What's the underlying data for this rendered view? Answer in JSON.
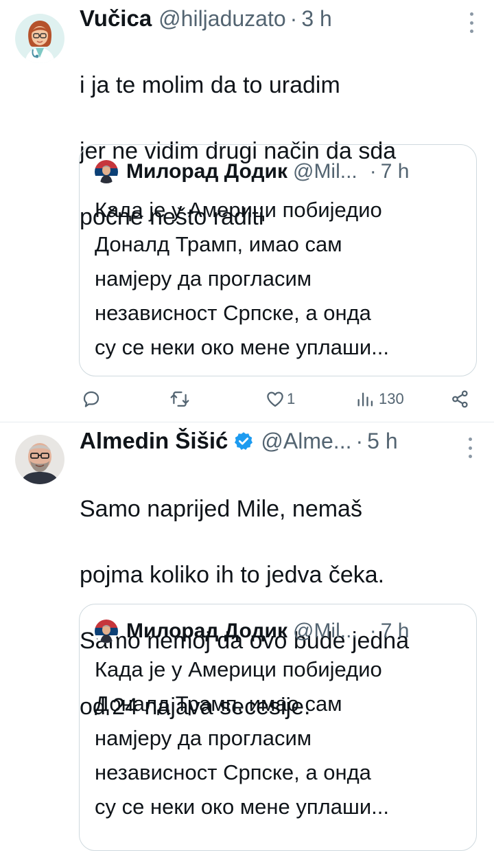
{
  "tweets": [
    {
      "display_name": "Vučica",
      "handle": "@hiljaduzato",
      "separator": "·",
      "time": "3 h",
      "text_lines": [
        "i ja te molim da to uradim",
        "jer ne vidim drugi način da sda",
        "počne nešto raditi"
      ],
      "quote": {
        "display_name": "Милорад Додик",
        "handle": "@Mil...",
        "separator": "·",
        "time": "7 h",
        "text_lines": [
          "Када је у Америци побиједио",
          "Доналд Трамп, имао сам",
          "намјеру да прогласим",
          "независност Српске, а онда",
          "су се неки око мене уплаши..."
        ]
      },
      "actions": {
        "reply_count": "",
        "retweet_count": "",
        "like_count": "1",
        "views_count": "130"
      }
    },
    {
      "display_name": "Almedin Šišić",
      "handle": "@Alme...",
      "separator": "·",
      "time": "5 h",
      "verified": true,
      "text_lines": [
        "Samo naprijed Mile, nemaš",
        "pojma koliko ih to jedva čeka.",
        "Samo nemoj da ovo bude jedna",
        "od 24 najava secesije."
      ],
      "quote": {
        "display_name": "Милорад Додик",
        "handle": "@Mil...",
        "separator": "·",
        "time": "7 h",
        "text_lines": [
          "Када је у Америци побиједио",
          "Доналд Трамп, имао сам",
          "намјеру да прогласим",
          "независност Српске, а онда",
          "су се неки око мене уплаши..."
        ]
      }
    }
  ],
  "icons": {
    "reply": "reply-icon",
    "retweet": "retweet-icon",
    "like": "heart-icon",
    "views": "views-icon",
    "share": "share-icon",
    "more": "more-icon",
    "verified": "verified-badge-icon"
  },
  "colors": {
    "text": "#0f1419",
    "secondary": "#536471",
    "border": "#cfd9de",
    "verified": "#1d9bf0"
  }
}
